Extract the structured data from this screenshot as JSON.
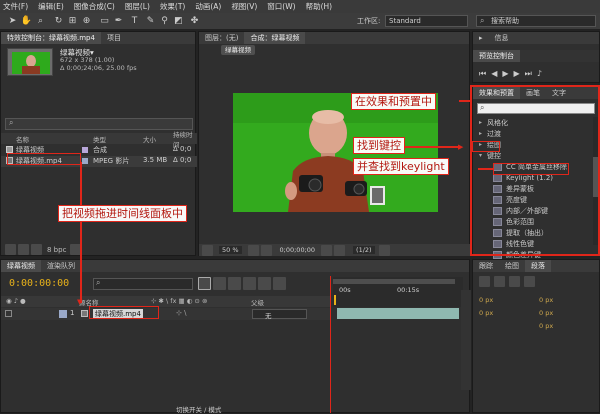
{
  "menu": [
    "文件(F)",
    "编辑(E)",
    "图像合成(C)",
    "图层(L)",
    "效果(T)",
    "动画(A)",
    "视图(V)",
    "窗口(W)",
    "帮助(H)"
  ],
  "workspace": {
    "label": "工作区:",
    "value": "Standard"
  },
  "search_help": "搜索帮助",
  "project": {
    "tab_title": "特效控制台：绿幕视频.mp4",
    "tab_project": "项目",
    "clip_name": "绿幕视频▾",
    "clip_size": "672 x 378 (1.00)",
    "clip_time": "Δ 0;00;24;06, 25.00 fps",
    "columns": [
      "名称",
      "类型",
      "大小",
      "持续时间"
    ],
    "rows": [
      {
        "name": "绿幕视频",
        "type": "合成",
        "size": "",
        "dur": "Δ 0;0"
      },
      {
        "name": "绿幕视频.mp4",
        "type": "MPEG 影片",
        "size": "3.5 MB",
        "dur": "Δ 0;0"
      }
    ],
    "bpc": "8 bpc"
  },
  "viewer": {
    "tab_image": "图层：(无)",
    "tab_comp": "合成：绿幕视频",
    "comp_button": "绿幕视频",
    "zoom": "50 %",
    "timecode": "0;00;00;00",
    "resolution": "(1/2)"
  },
  "right_top": {
    "tab_preview": "预览控制台",
    "tab_info": "信息"
  },
  "effects": {
    "tab_effects": "效果和预置",
    "tab_brush": "画笔",
    "tab_text": "文字",
    "tree": [
      "风格化",
      "过渡",
      "绘图",
      "键控"
    ],
    "keying": [
      "CC 简单金属丝移除",
      "Keylight (1.2)",
      "差异蒙板",
      "亮度键",
      "内部／外部键",
      "色彩范围",
      "提取（抽出）",
      "线性色键",
      "颜色差异键"
    ]
  },
  "right_bottom": {
    "tabs": [
      "跟踪",
      "绘图",
      "段落"
    ],
    "fields": [
      "0 px",
      "0 px",
      "0 px",
      "0 px",
      "0 px"
    ]
  },
  "timeline": {
    "tab_comp": "绿幕视频",
    "tab_render": "渲染队列",
    "timecode": "0:00:00:00",
    "col_source": "源名称",
    "col_parent": "父级",
    "layer_index": "1",
    "layer_name": "绿幕视频.mp4",
    "parent_value": "无",
    "ruler_start": "00s",
    "ruler_mid": "00:15s",
    "switch_mode": "切换开关 / 模式"
  },
  "annotations": {
    "a1": "在效果和预置中",
    "a2": "找到键控",
    "a3": "并查找到keylight",
    "a4": "把视频拖进时间线面板中"
  }
}
